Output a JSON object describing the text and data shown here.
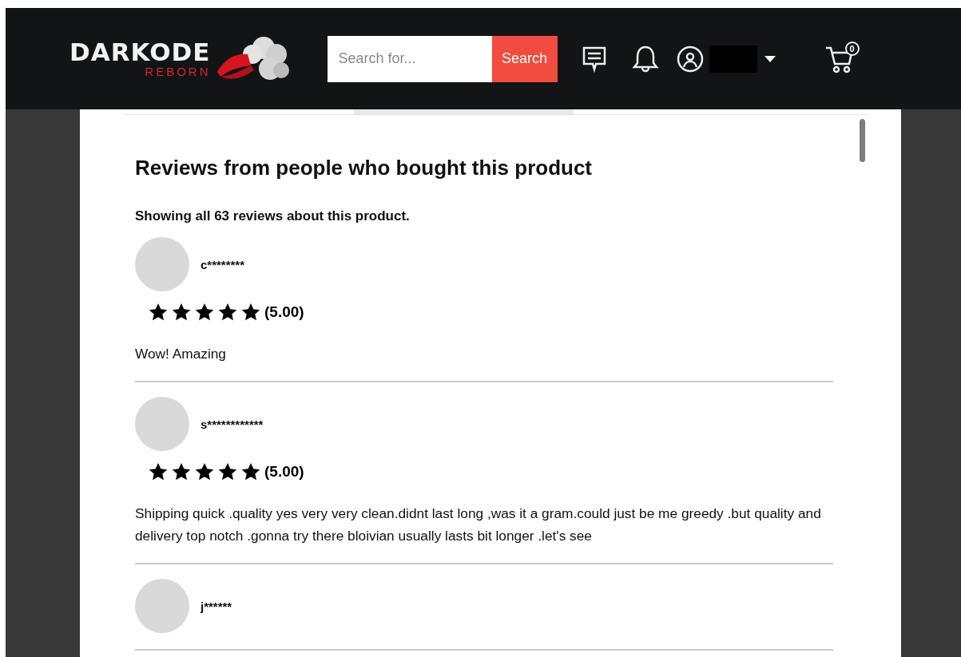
{
  "header": {
    "logo_title": "DARKODE",
    "logo_subtitle": "REBORN",
    "search": {
      "placeholder": "Search for...",
      "button": "Search"
    },
    "cart_count": "0"
  },
  "reviews_section": {
    "title": "Reviews from people who bought this product",
    "summary": "Showing all 63 reviews about this product.",
    "reviews": [
      {
        "user": "c********",
        "stars": 5,
        "rating": "(5.00)",
        "text": "Wow! Amazing"
      },
      {
        "user": "s************",
        "stars": 5,
        "rating": "(5.00)",
        "text": "Shipping quick .quality yes very very clean.didnt last long ,was it a gram.could just be me greedy .but quality and delivery top notch .gonna try there bloivian usually lasts bit longer .let's see"
      },
      {
        "user": "j******"
      }
    ]
  }
}
